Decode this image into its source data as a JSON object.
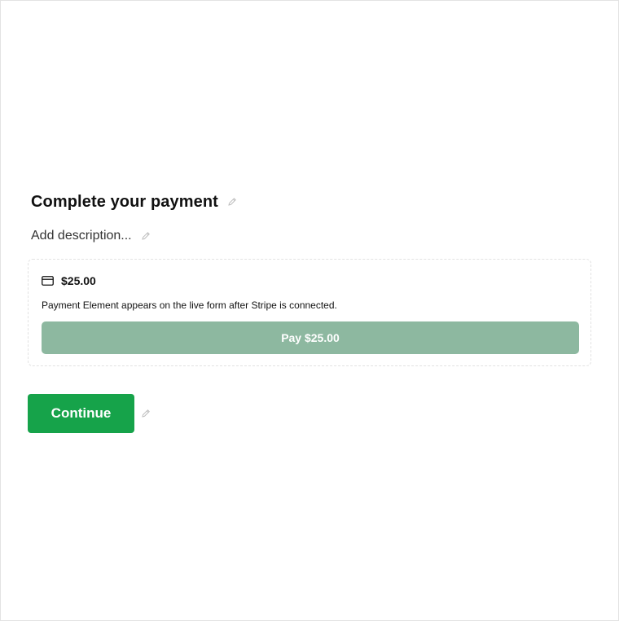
{
  "form": {
    "title": "Complete your payment",
    "description_placeholder": "Add description...",
    "icons": {
      "edit": "pencil-icon",
      "card": "credit-card-icon"
    }
  },
  "payment": {
    "amount": "$25.00",
    "note": "Payment Element appears on the live form after Stripe is connected.",
    "pay_label": "Pay $25.00",
    "pay_button_color": "#8db8a0"
  },
  "actions": {
    "continue_label": "Continue",
    "continue_color": "#16a34a"
  }
}
